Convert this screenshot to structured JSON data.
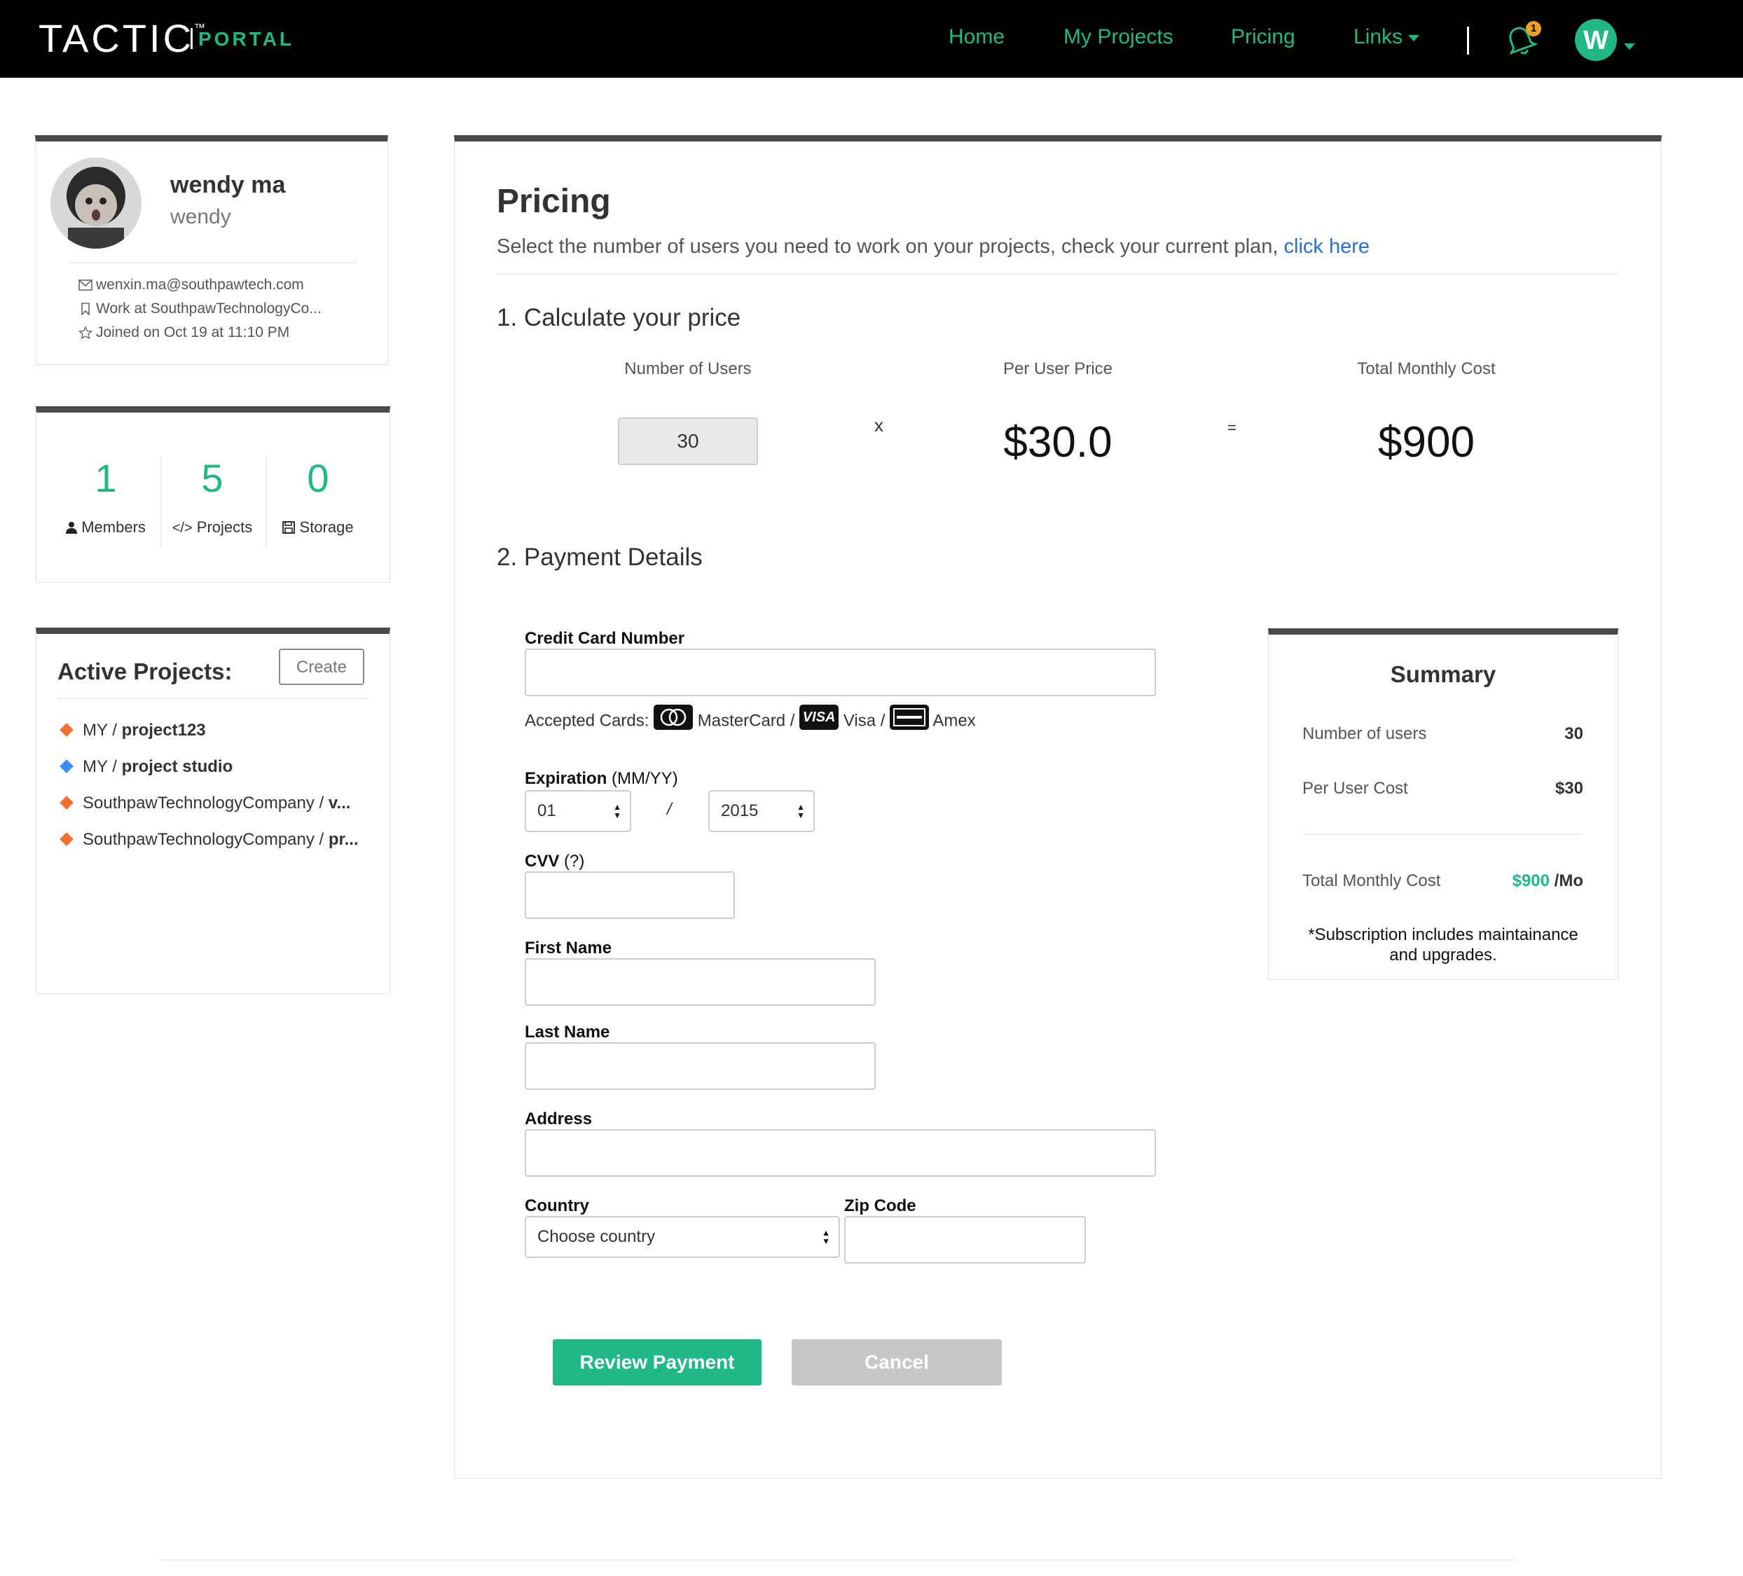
{
  "header": {
    "logo_main": "TACTIC",
    "logo_tm": "™",
    "logo_sub": "PORTAL",
    "nav": [
      "Home",
      "My Projects",
      "Pricing",
      "Links"
    ],
    "notification_count": "1",
    "user_initial": "W",
    "accent_color": "#1fb886"
  },
  "profile": {
    "name": "wendy ma",
    "username": "wendy",
    "email": "wenxin.ma@southpawtech.com",
    "work": "Work at SouthpawTechnologyCo...",
    "joined": "Joined on Oct 19 at 11:10 PM"
  },
  "stats": {
    "members_count": "1",
    "members_label": "Members",
    "projects_count": "5",
    "projects_label": "Projects",
    "storage_count": "0",
    "storage_label": "Storage"
  },
  "active_projects": {
    "title": "Active Projects:",
    "create_label": "Create",
    "items": [
      {
        "owner": "MY / ",
        "name": "project123",
        "color": "#f07030"
      },
      {
        "owner": "MY / ",
        "name": "project studio",
        "color": "#3c8dff"
      },
      {
        "owner": "SouthpawTechnologyCompany / ",
        "name": "v...",
        "color": "#f07030"
      },
      {
        "owner": "SouthpawTechnologyCompany / ",
        "name": "pr...",
        "color": "#f07030"
      }
    ]
  },
  "pricing": {
    "title": "Pricing",
    "subtitle": "Select the number of users you need to work on your projects, check your current plan, ",
    "subtitle_link": "click here",
    "section1": "1. Calculate your price",
    "col_users": "Number of Users",
    "col_per_user": "Per User Price",
    "col_total": "Total Monthly Cost",
    "users_value": "30",
    "times": "x",
    "per_user_price": "$30.0",
    "equals": "=",
    "total_cost": "$900",
    "section2": "2. Payment Details"
  },
  "form": {
    "cc_label": "Credit Card Number",
    "accepted_label": "Accepted Cards: ",
    "mastercard": "MasterCard /",
    "visa": "Visa /",
    "amex": "Amex",
    "visa_icon": "VISA",
    "expiration_label": "Expiration",
    "expiration_hint": "(MM/YY)",
    "exp_month": "01",
    "exp_sep": "/",
    "exp_year": "2015",
    "cvv_label": "CVV",
    "cvv_hint": "(?)",
    "first_name_label": "First Name",
    "last_name_label": "Last Name",
    "address_label": "Address",
    "country_label": "Country",
    "country_value": "Choose country",
    "zip_label": "Zip Code",
    "review_label": "Review Payment",
    "cancel_label": "Cancel"
  },
  "summary": {
    "title": "Summary",
    "users_label": "Number of users",
    "users_value": "30",
    "per_user_label": "Per User Cost",
    "per_user_value": "$30",
    "total_label": "Total Monthly Cost",
    "total_value": "$900",
    "total_suffix": " /Mo",
    "note": "*Subscription includes maintainance and upgrades."
  }
}
